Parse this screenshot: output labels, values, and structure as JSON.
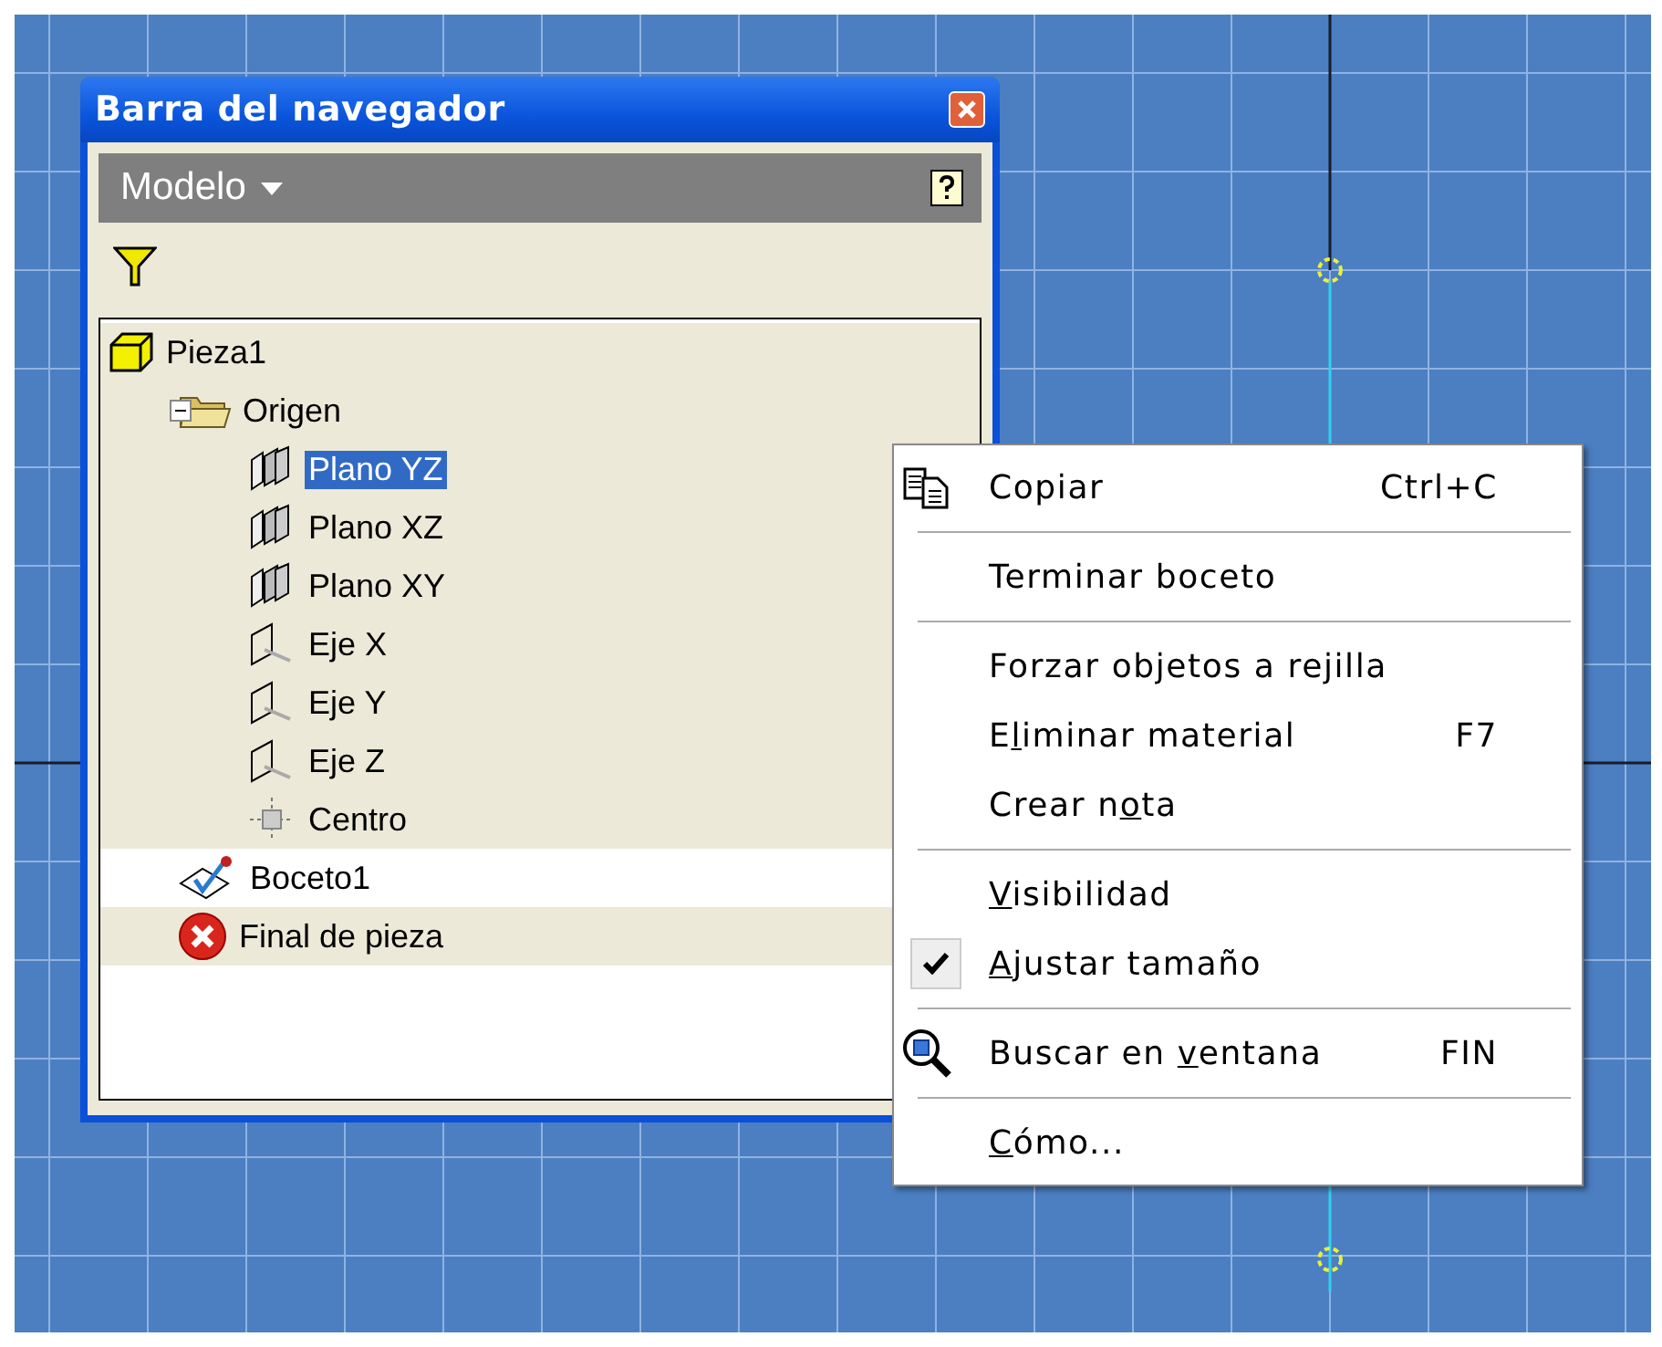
{
  "navigator": {
    "title": "Barra del navegador",
    "view_menu": "Modelo",
    "tree": [
      {
        "label": "Pieza1",
        "kind": "part",
        "selected": false,
        "active": false,
        "expanded": true,
        "children": [
          {
            "label": "Origen",
            "kind": "folder",
            "selected": false,
            "active": false,
            "expanded": true,
            "children": [
              {
                "label": "Plano YZ",
                "kind": "plane",
                "selected": true,
                "active": false
              },
              {
                "label": "Plano XZ",
                "kind": "plane",
                "selected": false,
                "active": false
              },
              {
                "label": "Plano XY",
                "kind": "plane",
                "selected": false,
                "active": false
              },
              {
                "label": "Eje X",
                "kind": "axis",
                "selected": false,
                "active": false
              },
              {
                "label": "Eje Y",
                "kind": "axis",
                "selected": false,
                "active": false
              },
              {
                "label": "Eje Z",
                "kind": "axis",
                "selected": false,
                "active": false
              },
              {
                "label": "Centro",
                "kind": "point",
                "selected": false,
                "active": false
              }
            ]
          },
          {
            "label": "Boceto1",
            "kind": "sketch",
            "selected": false,
            "active": true
          },
          {
            "label": "Final de pieza",
            "kind": "end",
            "selected": false,
            "active": false
          }
        ]
      }
    ]
  },
  "context_menu": {
    "groups": [
      [
        {
          "before": "Copiar",
          "shortcut": "Ctrl+C",
          "kind": "copy",
          "checked": false
        }
      ],
      [
        {
          "before": "Terminar boceto",
          "kind": "plain",
          "checked": false
        }
      ],
      [
        {
          "before": "Forzar objetos a rejilla",
          "kind": "plain",
          "checked": false
        },
        {
          "before": "E",
          "mnemonic": "l",
          "after": "iminar material",
          "shortcut": "F7",
          "kind": "plain",
          "checked": false
        },
        {
          "before": "Crear n",
          "mnemonic": "o",
          "after": "ta",
          "kind": "plain",
          "checked": false
        }
      ],
      [
        {
          "mnemonic": "V",
          "after": "isibilidad",
          "kind": "plain",
          "checked": false
        },
        {
          "mnemonic": "A",
          "after": "justar tamaño",
          "checked": true
        }
      ],
      [
        {
          "before": "Buscar en ",
          "mnemonic": "v",
          "after": "entana",
          "shortcut": "FIN",
          "kind": "zoom",
          "checked": false
        }
      ],
      [
        {
          "mnemonic": "C",
          "after": "ómo...",
          "kind": "plain",
          "checked": false
        }
      ]
    ]
  }
}
